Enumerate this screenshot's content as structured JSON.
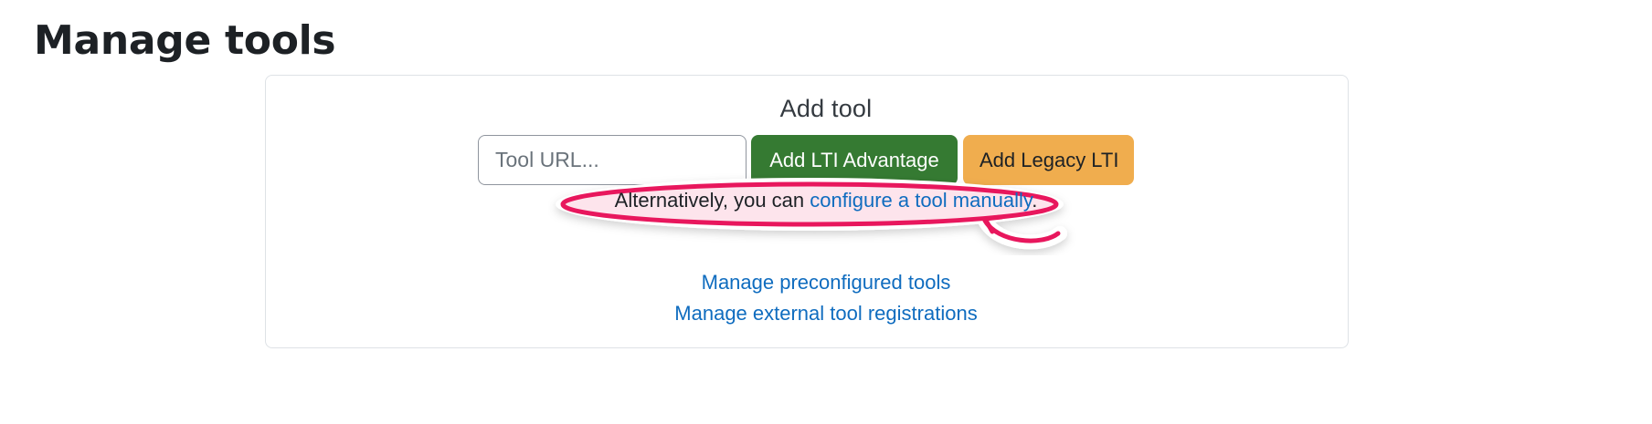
{
  "page": {
    "title": "Manage tools"
  },
  "add_tool": {
    "heading": "Add tool",
    "url_placeholder": "Tool URL...",
    "url_value": "",
    "btn_advantage": "Add LTI Advantage",
    "btn_legacy": "Add Legacy LTI",
    "alt_prefix": "Alternatively, you can ",
    "alt_link": "configure a tool manually",
    "alt_suffix": ".",
    "links": [
      "Manage preconfigured tools",
      "Manage external tool registrations"
    ]
  },
  "colors": {
    "advantage_green": "#357a32",
    "legacy_orange": "#f0ad4e",
    "link_blue": "#0f6cbf",
    "highlight_pink": "#e8175d"
  }
}
